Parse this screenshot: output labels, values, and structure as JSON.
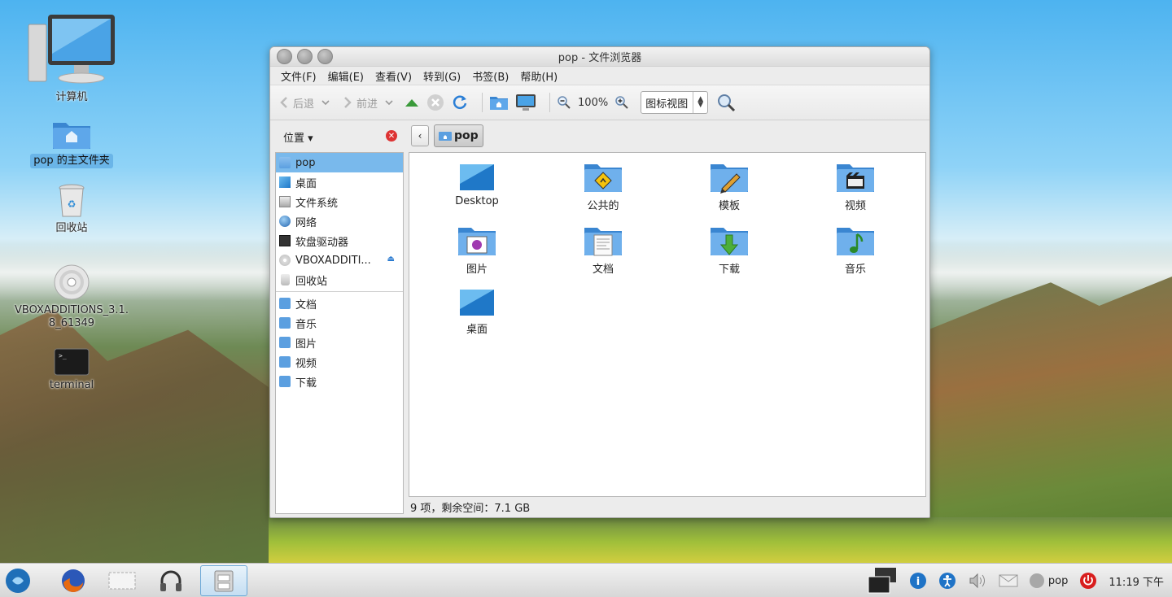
{
  "desktop": {
    "icons": [
      {
        "label": "计算机"
      },
      {
        "label": "pop 的主文件夹"
      },
      {
        "label": "回收站"
      },
      {
        "label": "VBOXADDITIONS_3.1.8_61349"
      },
      {
        "label": "terminal"
      }
    ]
  },
  "window": {
    "title": "pop - 文件浏览器",
    "menu": [
      "文件(F)",
      "编辑(E)",
      "查看(V)",
      "转到(G)",
      "书签(B)",
      "帮助(H)"
    ],
    "toolbar": {
      "back_label": "后退",
      "forward_label": "前进",
      "zoom_level": "100%",
      "view_mode": "图标视图"
    },
    "sidebar": {
      "header": "位置",
      "places": [
        {
          "label": "pop",
          "icon": "home-folder-icon"
        },
        {
          "label": "桌面",
          "icon": "desktop-icon"
        },
        {
          "label": "文件系统",
          "icon": "drive-icon"
        },
        {
          "label": "网络",
          "icon": "network-icon"
        },
        {
          "label": "软盘驱动器",
          "icon": "floppy-icon"
        },
        {
          "label": "VBOXADDITI...",
          "icon": "cd-icon"
        },
        {
          "label": "回收站",
          "icon": "trash-icon"
        }
      ],
      "bookmarks": [
        {
          "label": "文档",
          "icon": "documents-folder-icon"
        },
        {
          "label": "音乐",
          "icon": "music-folder-icon"
        },
        {
          "label": "图片",
          "icon": "pictures-folder-icon"
        },
        {
          "label": "视频",
          "icon": "videos-folder-icon"
        },
        {
          "label": "下载",
          "icon": "downloads-folder-icon"
        }
      ]
    },
    "pathbar": {
      "current": "pop"
    },
    "files": [
      {
        "label": "Desktop",
        "icon": "desktop-icon"
      },
      {
        "label": "公共的",
        "icon": "public-folder-icon"
      },
      {
        "label": "模板",
        "icon": "templates-folder-icon"
      },
      {
        "label": "视频",
        "icon": "videos-folder-icon"
      },
      {
        "label": "图片",
        "icon": "pictures-folder-icon"
      },
      {
        "label": "文档",
        "icon": "documents-folder-icon"
      },
      {
        "label": "下载",
        "icon": "downloads-folder-icon"
      },
      {
        "label": "音乐",
        "icon": "music-folder-icon"
      },
      {
        "label": "桌面",
        "icon": "desktop-icon"
      }
    ],
    "status": "9 项，剩余空间：7.1 GB"
  },
  "taskbar": {
    "user": "pop",
    "clock": "11:19 下午"
  },
  "colors": {
    "accent": "#79b9ec",
    "folder": "#5b9fe0"
  }
}
